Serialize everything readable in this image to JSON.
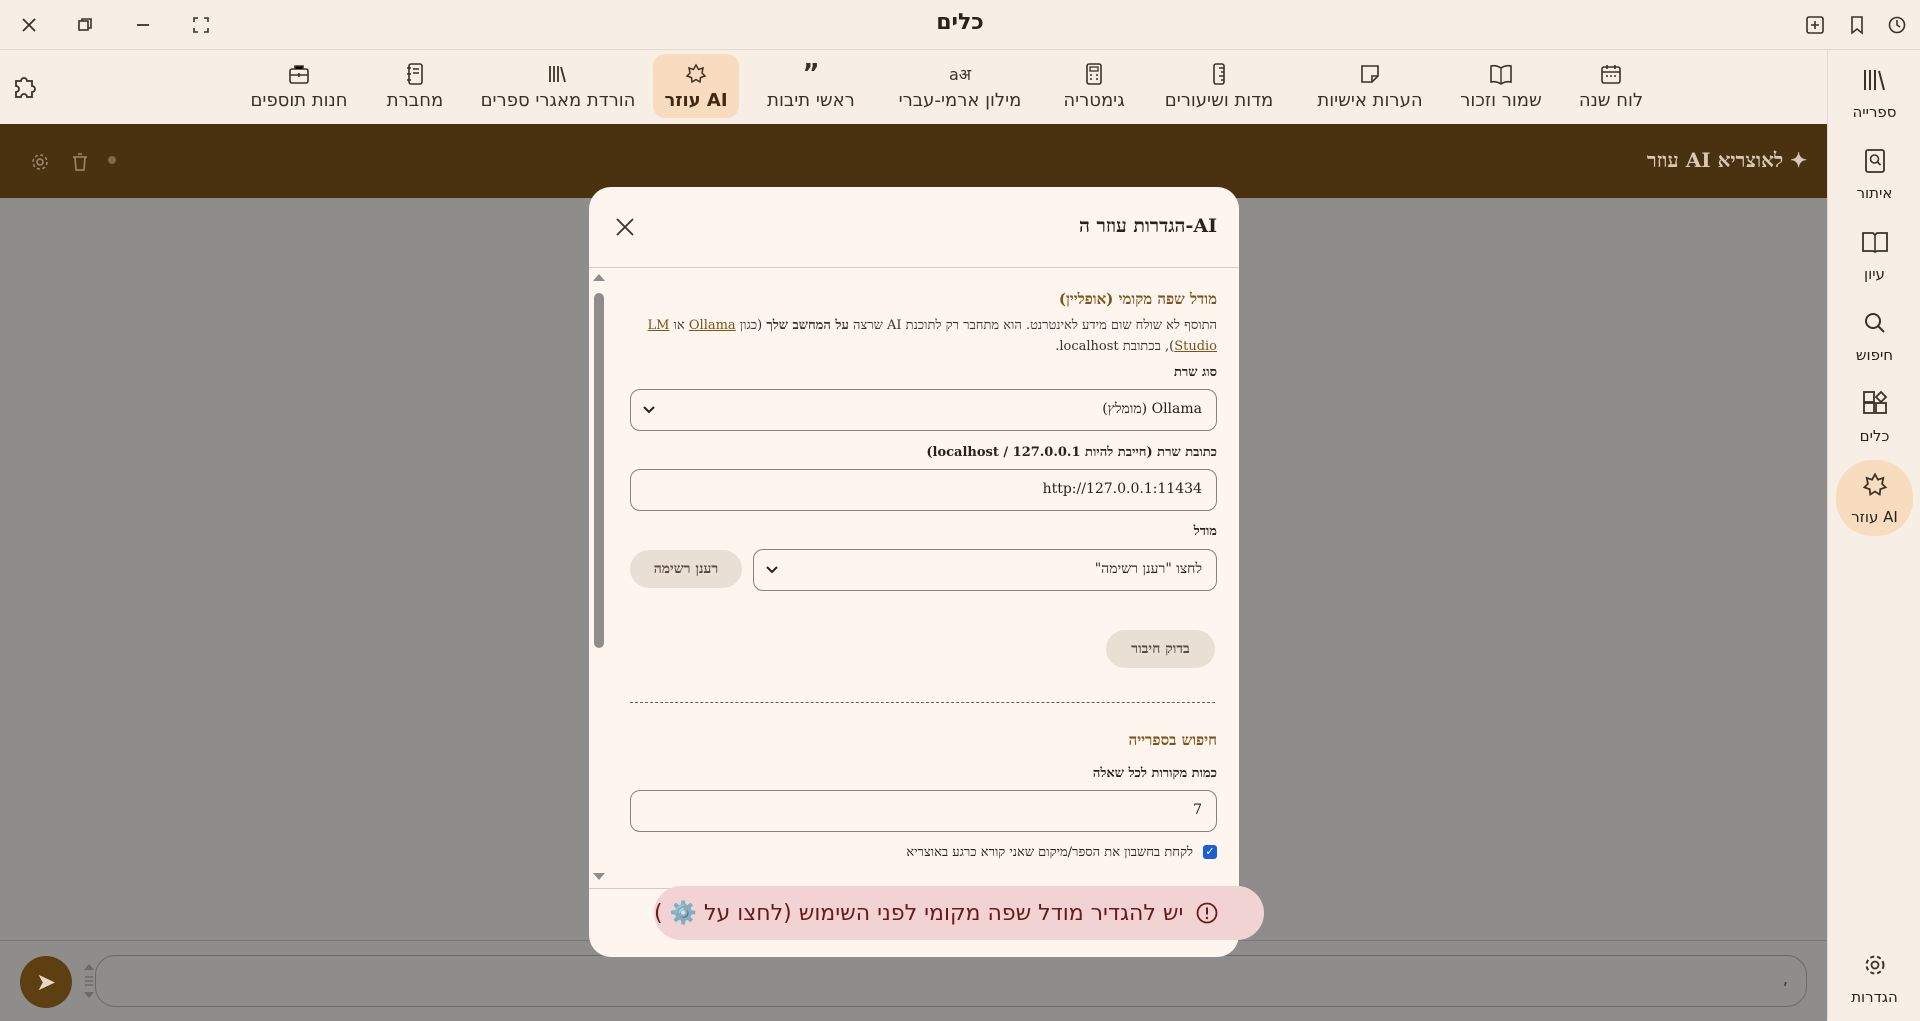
{
  "window": {
    "title": "כלים"
  },
  "rail": {
    "items": [
      {
        "label": "ספרייה",
        "icon": "library-icon"
      },
      {
        "label": "איתור",
        "icon": "find-book-icon"
      },
      {
        "label": "עיון",
        "icon": "book-open-icon"
      },
      {
        "label": "חיפוש",
        "icon": "search-icon"
      },
      {
        "label": "כלים",
        "icon": "tools-icon"
      },
      {
        "label": "עוזר AI",
        "icon": "ai-assistant-icon",
        "active": true
      }
    ],
    "settings_label": "הגדרות"
  },
  "tools": {
    "items": [
      {
        "label": "לוח שנה",
        "icon": "calendar-icon"
      },
      {
        "label": "שמור וזכור",
        "icon": "book-bookmark-icon"
      },
      {
        "label": "הערות אישיות",
        "icon": "note-icon"
      },
      {
        "label": "מדות ושיעורים",
        "icon": "ruler-icon"
      },
      {
        "label": "גימטריה",
        "icon": "calculator-icon"
      },
      {
        "label": "מילון ארמי-עברי",
        "icon": "translate-icon"
      },
      {
        "label": "ראשי תיבות",
        "icon": "quote-icon"
      },
      {
        "label": "עוזר AI",
        "icon": "ai-assistant-icon",
        "active": true
      },
      {
        "label": "הורדת מאגרי ספרים",
        "icon": "books-download-icon"
      },
      {
        "label": "מחברת",
        "icon": "notebook-icon"
      },
      {
        "label": "חנות תוספים",
        "icon": "store-icon"
      }
    ]
  },
  "ai_header": {
    "title": "עוזר AI לאוצריא ✦"
  },
  "modal": {
    "title": "הגדרות עוזר ה-AI",
    "local_section_title": "מודל שפה מקומי (אופליין)",
    "desc_part1": "התוסף לא שולח שום מידע לאינטרנט. הוא מתחבר רק לתוכנת AI שרצה ",
    "desc_bold": "על המחשב שלך",
    "desc_part2": " (כגון ",
    "desc_link1": "Ollama",
    "desc_part3": " או ",
    "desc_link2": "LM Studio",
    "desc_part4": "), בכתובת localhost.",
    "server_type_label": "סוג שרת",
    "server_type_value": "Ollama (מומלץ)",
    "server_url_label": "כתובת שרת (חייבת להיות localhost / 127.0.0.1)",
    "server_url_value": "http://127.0.0.1:11434",
    "model_label": "מודל",
    "model_value": "לחצו \"רענן רשימה\"",
    "refresh_button": "רענן רשימה",
    "test_button": "בדוק חיבור",
    "library_section_title": "חיפוש בספרייה",
    "sources_label": "כמות מקורות לכל שאלה",
    "sources_value": "7",
    "context_checkbox_label": "לקחת בחשבון את הספר/מיקום שאני קורא כרגע באוצריא",
    "context_checkbox_checked": true
  },
  "toast": {
    "text": "יש להגדיר מודל שפה מקומי לפני השימוש (לחצו על ⚙️ )"
  },
  "composer": {
    "placeholder": ","
  },
  "colors": {
    "accent": "#7a5418",
    "header_brown": "#4a3210",
    "active_bg": "#f7dcc0",
    "toast_bg": "#f2d3d3"
  }
}
